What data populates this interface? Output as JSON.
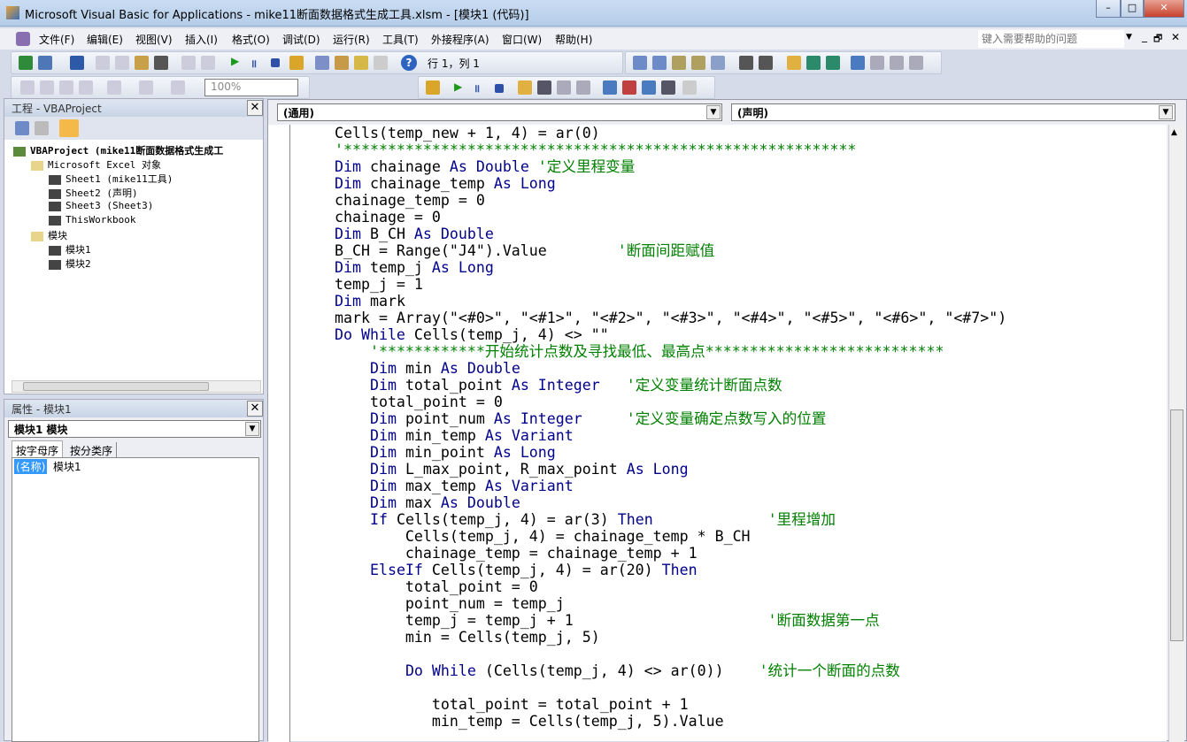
{
  "window": {
    "title": "Microsoft Visual Basic for Applications - mike11断面数据格式生成工具.xlsm - [模块1 (代码)]",
    "minimize": "–",
    "maximize": "□",
    "close": "✕"
  },
  "menu": [
    "文件(F)",
    "编辑(E)",
    "视图(V)",
    "插入(I)",
    "格式(O)",
    "调试(D)",
    "运行(R)",
    "工具(T)",
    "外接程序(A)",
    "窗口(W)",
    "帮助(H)"
  ],
  "help_placeholder": "键入需要帮助的问题",
  "mdi": {
    "minimize": "_",
    "restore": "🗗",
    "close": "✕"
  },
  "toolbar": {
    "position": "行 1，列 1",
    "zoom": "100%"
  },
  "project": {
    "title": "工程 - VBAProject",
    "tree": [
      {
        "label": "VBAProject (mike11断面数据格式生成工",
        "level": 0,
        "bold": true
      },
      {
        "label": "Microsoft Excel 对象",
        "level": 1
      },
      {
        "label": "Sheet1 (mike11工具)",
        "level": 2
      },
      {
        "label": "Sheet2 (声明)",
        "level": 2
      },
      {
        "label": "Sheet3 (Sheet3)",
        "level": 2
      },
      {
        "label": "ThisWorkbook",
        "level": 2
      },
      {
        "label": "模块",
        "level": 1
      },
      {
        "label": "模块1",
        "level": 2
      },
      {
        "label": "模块2",
        "level": 2
      }
    ]
  },
  "properties": {
    "title": "属性 - 模块1",
    "object": "模块1 模块",
    "tabs": [
      "按字母序",
      "按分类序"
    ],
    "prop_name": "(名称)",
    "prop_value": "模块1"
  },
  "code_header": {
    "object": "(通用)",
    "procedure": "(声明)"
  },
  "code_lines": [
    [
      [
        "n",
        "Cells(temp_new + 1, 4) = ar(0)"
      ]
    ],
    [
      [
        "c",
        "'**********************************************************"
      ]
    ],
    [
      [
        "k",
        "Dim "
      ],
      [
        "n",
        "chainage "
      ],
      [
        "k",
        "As Double "
      ],
      [
        "c",
        "'定义里程变量"
      ]
    ],
    [
      [
        "k",
        "Dim "
      ],
      [
        "n",
        "chainage_temp "
      ],
      [
        "k",
        "As Long"
      ]
    ],
    [
      [
        "n",
        "chainage_temp = 0"
      ]
    ],
    [
      [
        "n",
        "chainage = 0"
      ]
    ],
    [
      [
        "k",
        "Dim "
      ],
      [
        "n",
        "B_CH "
      ],
      [
        "k",
        "As Double"
      ]
    ],
    [
      [
        "n",
        "B_CH = Range(\"J4\").Value        "
      ],
      [
        "c",
        "'断面间距赋值"
      ]
    ],
    [
      [
        "k",
        "Dim "
      ],
      [
        "n",
        "temp_j "
      ],
      [
        "k",
        "As Long"
      ]
    ],
    [
      [
        "n",
        "temp_j = 1"
      ]
    ],
    [
      [
        "k",
        "Dim "
      ],
      [
        "n",
        "mark"
      ]
    ],
    [
      [
        "n",
        "mark = Array(\"<#0>\", \"<#1>\", \"<#2>\", \"<#3>\", \"<#4>\", \"<#5>\", \"<#6>\", \"<#7>\")"
      ]
    ],
    [
      [
        "k",
        "Do While "
      ],
      [
        "n",
        "Cells(temp_j, 4) <> \"\""
      ]
    ],
    [
      [
        "n",
        "    "
      ],
      [
        "c",
        "'************开始统计点数及寻找最低、最高点***************************"
      ]
    ],
    [
      [
        "n",
        "    "
      ],
      [
        "k",
        "Dim "
      ],
      [
        "n",
        "min "
      ],
      [
        "k",
        "As Double"
      ]
    ],
    [
      [
        "n",
        "    "
      ],
      [
        "k",
        "Dim "
      ],
      [
        "n",
        "total_point "
      ],
      [
        "k",
        "As Integer"
      ],
      [
        "n",
        "   "
      ],
      [
        "c",
        "'定义变量统计断面点数"
      ]
    ],
    [
      [
        "n",
        "    total_point = 0"
      ]
    ],
    [
      [
        "n",
        "    "
      ],
      [
        "k",
        "Dim "
      ],
      [
        "n",
        "point_num "
      ],
      [
        "k",
        "As Integer"
      ],
      [
        "n",
        "     "
      ],
      [
        "c",
        "'定义变量确定点数写入的位置"
      ]
    ],
    [
      [
        "n",
        "    "
      ],
      [
        "k",
        "Dim "
      ],
      [
        "n",
        "min_temp "
      ],
      [
        "k",
        "As Variant"
      ]
    ],
    [
      [
        "n",
        "    "
      ],
      [
        "k",
        "Dim "
      ],
      [
        "n",
        "min_point "
      ],
      [
        "k",
        "As Long"
      ]
    ],
    [
      [
        "n",
        "    "
      ],
      [
        "k",
        "Dim "
      ],
      [
        "n",
        "L_max_point, R_max_point "
      ],
      [
        "k",
        "As Long"
      ]
    ],
    [
      [
        "n",
        "    "
      ],
      [
        "k",
        "Dim "
      ],
      [
        "n",
        "max_temp "
      ],
      [
        "k",
        "As Variant"
      ]
    ],
    [
      [
        "n",
        "    "
      ],
      [
        "k",
        "Dim "
      ],
      [
        "n",
        "max "
      ],
      [
        "k",
        "As Double"
      ]
    ],
    [
      [
        "n",
        "    "
      ],
      [
        "k",
        "If "
      ],
      [
        "n",
        "Cells(temp_j, 4) = ar(3) "
      ],
      [
        "k",
        "Then"
      ],
      [
        "n",
        "             "
      ],
      [
        "c",
        "'里程增加"
      ]
    ],
    [
      [
        "n",
        "        Cells(temp_j, 4) = chainage_temp * B_CH"
      ]
    ],
    [
      [
        "n",
        "        chainage_temp = chainage_temp + 1"
      ]
    ],
    [
      [
        "n",
        "    "
      ],
      [
        "k",
        "ElseIf "
      ],
      [
        "n",
        "Cells(temp_j, 4) = ar(20) "
      ],
      [
        "k",
        "Then"
      ]
    ],
    [
      [
        "n",
        "        total_point = 0"
      ]
    ],
    [
      [
        "n",
        "        point_num = temp_j"
      ]
    ],
    [
      [
        "n",
        "        temp_j = temp_j + 1                      "
      ],
      [
        "c",
        "'断面数据第一点"
      ]
    ],
    [
      [
        "n",
        "        min = Cells(temp_j, 5)"
      ]
    ],
    [
      [
        "n",
        ""
      ]
    ],
    [
      [
        "n",
        "        "
      ],
      [
        "k",
        "Do While "
      ],
      [
        "n",
        "(Cells(temp_j, 4) <> ar(0))    "
      ],
      [
        "c",
        "'统计一个断面的点数"
      ]
    ],
    [
      [
        "n",
        ""
      ]
    ],
    [
      [
        "n",
        "           total_point = total_point + 1"
      ]
    ],
    [
      [
        "n",
        "           min_temp = Cells(temp_j, 5).Value"
      ]
    ]
  ],
  "colors": {
    "keyword": "#00008b",
    "comment": "#008000",
    "selection": "#3399ff"
  }
}
